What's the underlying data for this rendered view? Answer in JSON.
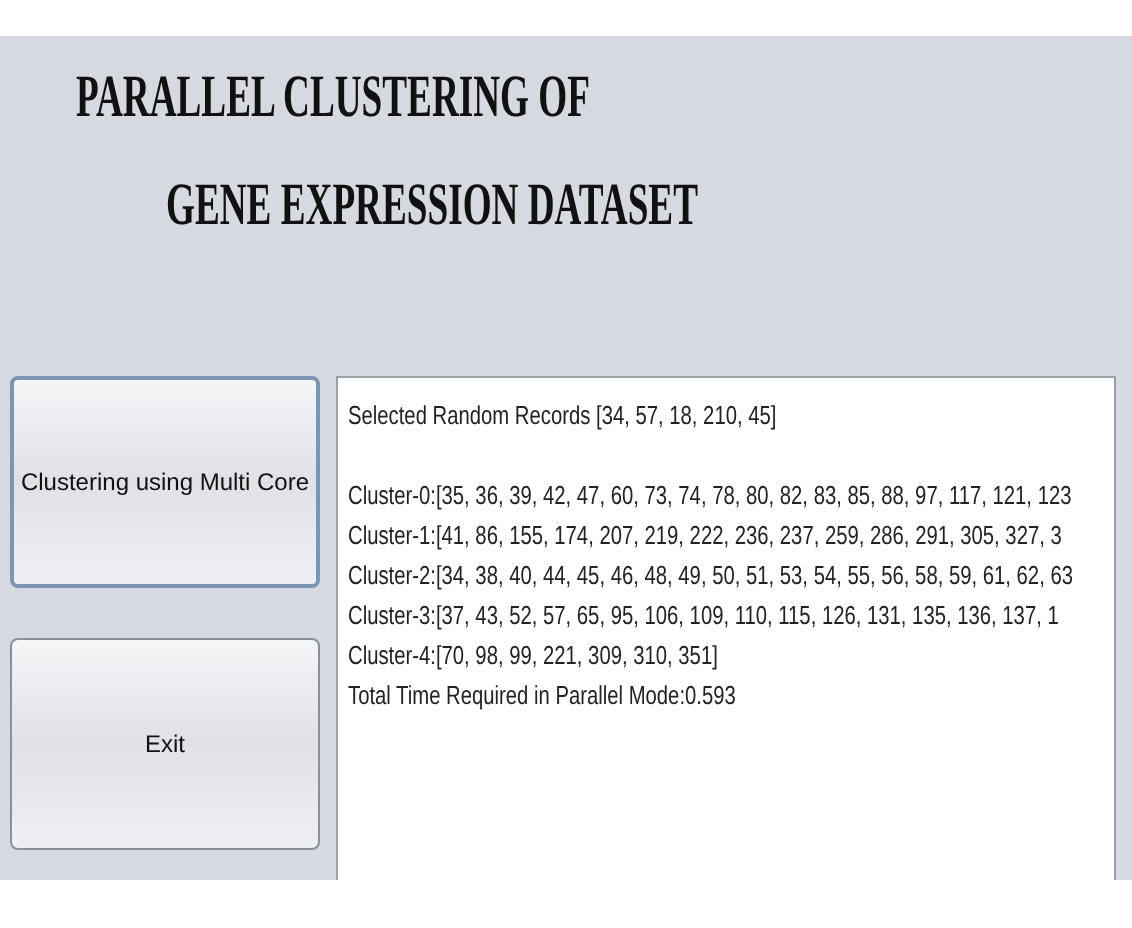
{
  "title_lines": [
    "PARALLEL CLUSTERING OF",
    "GENE EXPRESSION DATASET"
  ],
  "buttons": [
    {
      "label": "Clustering using Multi Core",
      "focused": true
    },
    {
      "label": "Exit",
      "focused": false
    }
  ],
  "output_lines": [
    "Selected Random Records  [34, 57, 18, 210, 45]",
    "Cluster-0:[35, 36, 39, 42, 47, 60, 73, 74, 78, 80, 82, 83, 85, 88, 97, 117, 121, 123",
    "Cluster-1:[41, 86, 155, 174, 207, 219, 222, 236, 237, 259, 286, 291, 305, 327, 3",
    "Cluster-2:[34, 38, 40, 44, 45, 46, 48, 49, 50, 51, 53, 54, 55, 56, 58, 59, 61, 62, 63",
    "Cluster-3:[37, 43, 52, 57, 65, 95, 106, 109, 110, 115, 126, 131, 135, 136, 137, 1",
    "Cluster-4:[70, 98, 99, 221, 309, 310, 351]",
    "Total Time Required in Parallel Mode:0.593"
  ]
}
